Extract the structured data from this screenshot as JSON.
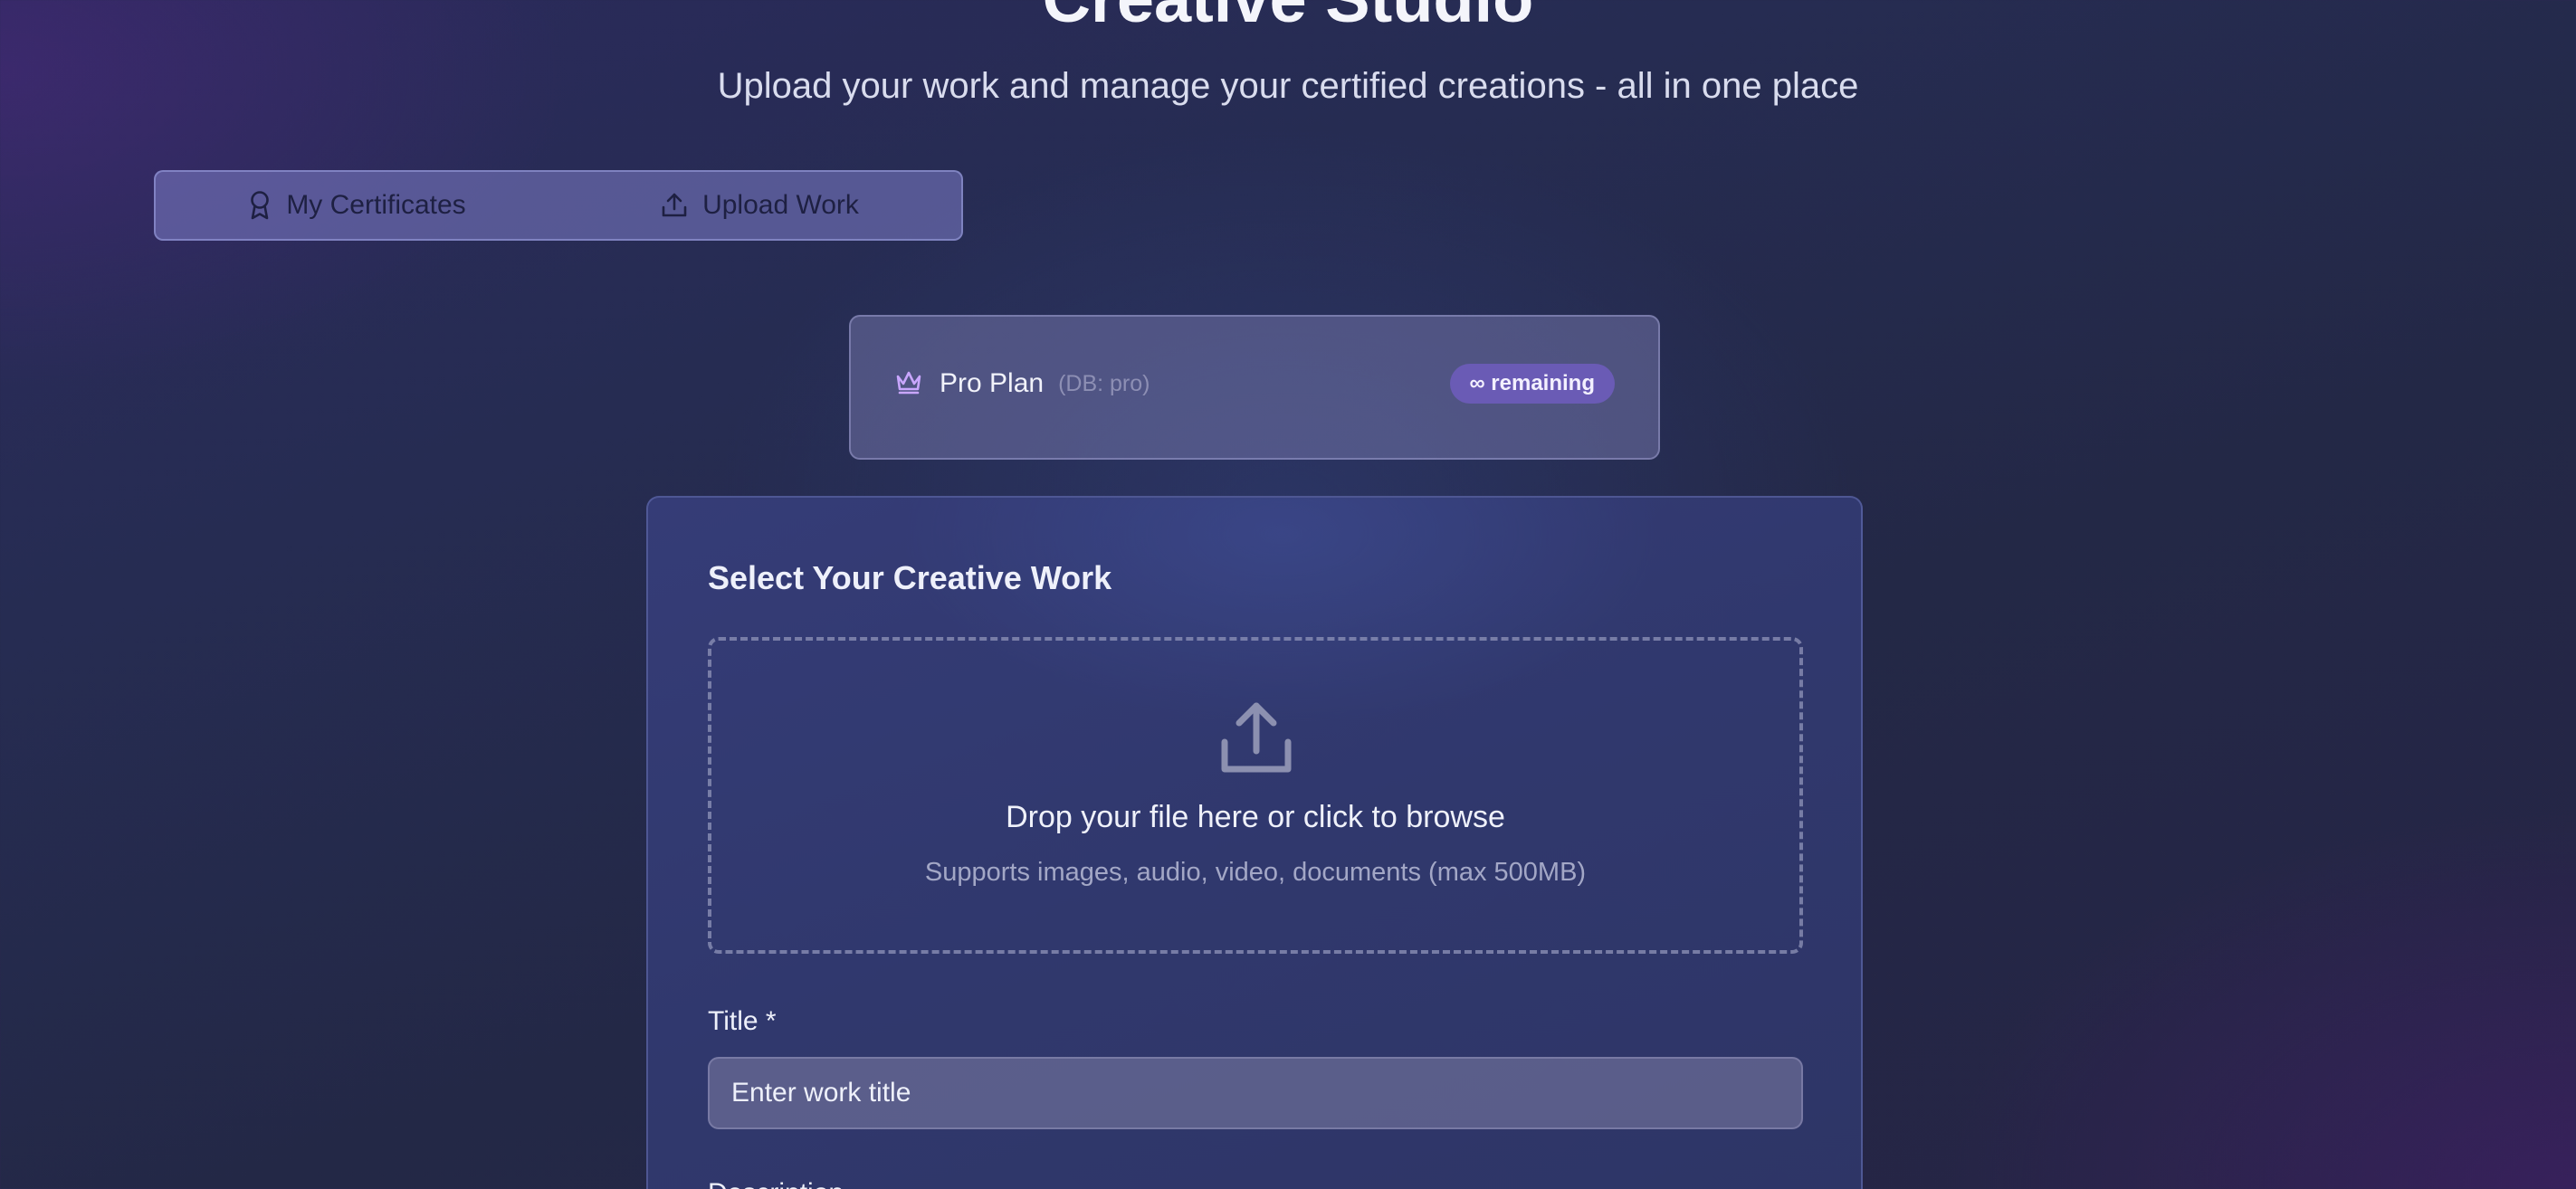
{
  "header": {
    "title": "Creative Studio",
    "subtitle": "Upload your work and manage your certified creations - all in one place"
  },
  "tabs": [
    {
      "label": "My Certificates",
      "icon": "award-icon",
      "active": false
    },
    {
      "label": "Upload Work",
      "icon": "upload-icon",
      "active": true
    }
  ],
  "plan": {
    "icon": "crown-icon",
    "name": "Pro Plan",
    "db_note": "(DB: pro)",
    "badge": "∞ remaining"
  },
  "upload": {
    "section_title": "Select Your Creative Work",
    "dropzone": {
      "icon": "upload-icon",
      "main_text": "Drop your file here or click to browse",
      "sub_text": "Supports images, audio, video, documents (max 500MB)"
    },
    "title_field": {
      "label": "Title *",
      "placeholder": "Enter work title",
      "value": ""
    },
    "description_field": {
      "label": "Description"
    }
  },
  "colors": {
    "accent": "#6a5bb5",
    "crown": "#c9a6ff"
  }
}
